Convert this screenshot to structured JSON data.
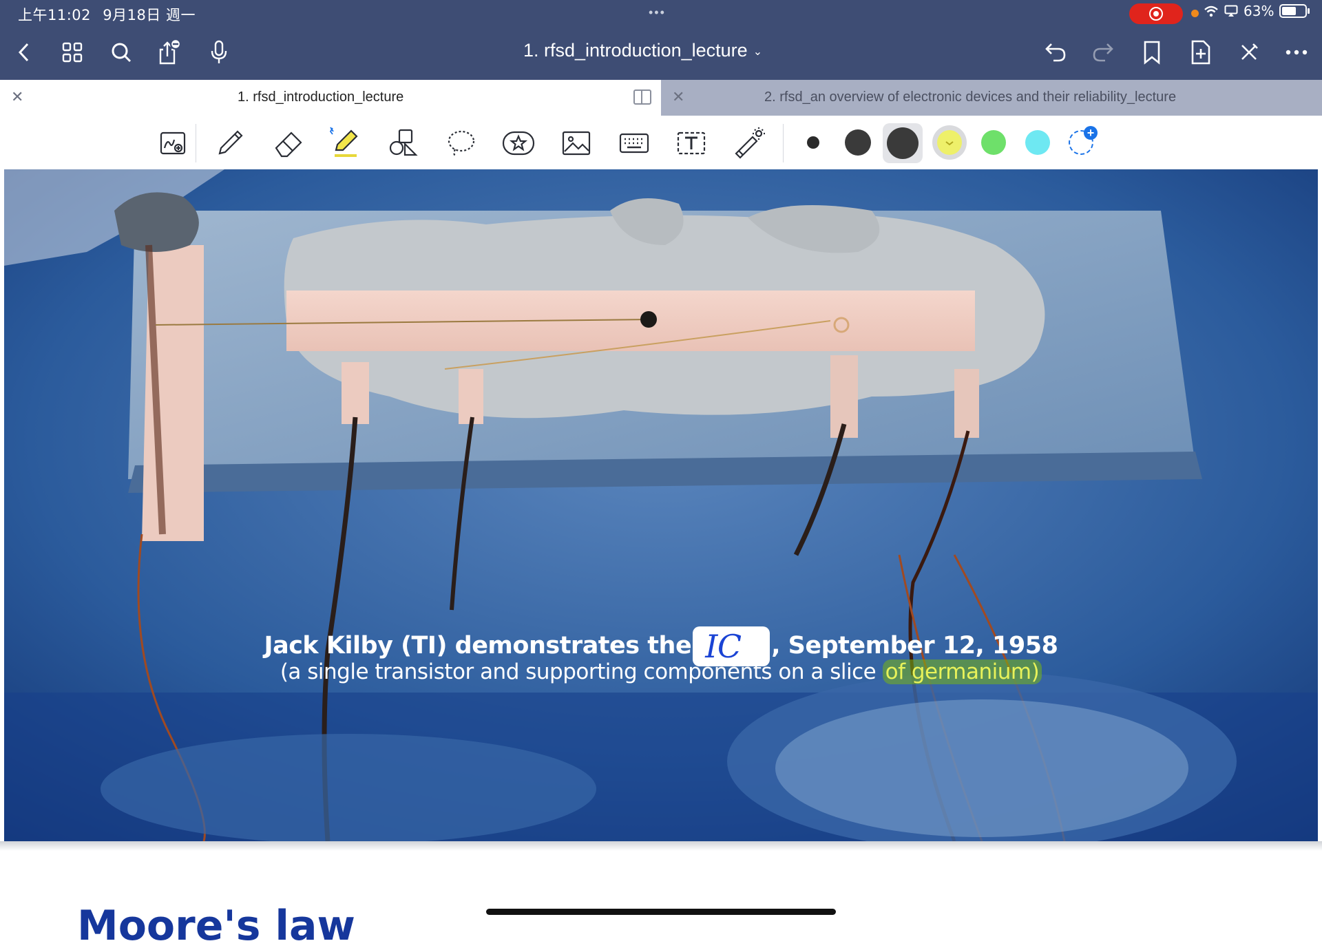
{
  "status_bar": {
    "time": "上午11:02",
    "date": "9月18日 週一",
    "battery": "63%",
    "battery_level": 0.63
  },
  "nav": {
    "doc_title": "1. rfsd_introduction_lecture"
  },
  "tabs": [
    {
      "label": "1. rfsd_introduction_lecture",
      "active": true
    },
    {
      "label": "2. rfsd_an overview of electronic devices and their reliability_lecture",
      "active": false
    }
  ],
  "toolbar": {
    "tools": [
      "zoom-window-icon",
      "pen-icon",
      "eraser-icon",
      "highlighter-icon",
      "shapes-icon",
      "lasso-icon",
      "sticker-icon",
      "image-icon",
      "keyboard-icon",
      "text-box-icon",
      "laser-pointer-icon"
    ],
    "sizes": [
      "small",
      "medium",
      "large"
    ],
    "colors": [
      "#eef06a",
      "#6ee06a",
      "#6ee8f2"
    ],
    "selected_color": "#eef06a"
  },
  "slide": {
    "caption_line1_before": "Jack Kilby (TI) demonstrates the",
    "handwritten": "IC",
    "caption_line1_after": ", September 12, 1958",
    "caption_line2_before": "(a single transistor and supporting components on a slice ",
    "caption_line2_highlight": "of germanium)"
  },
  "next_slide": {
    "title": "Moore's law"
  }
}
